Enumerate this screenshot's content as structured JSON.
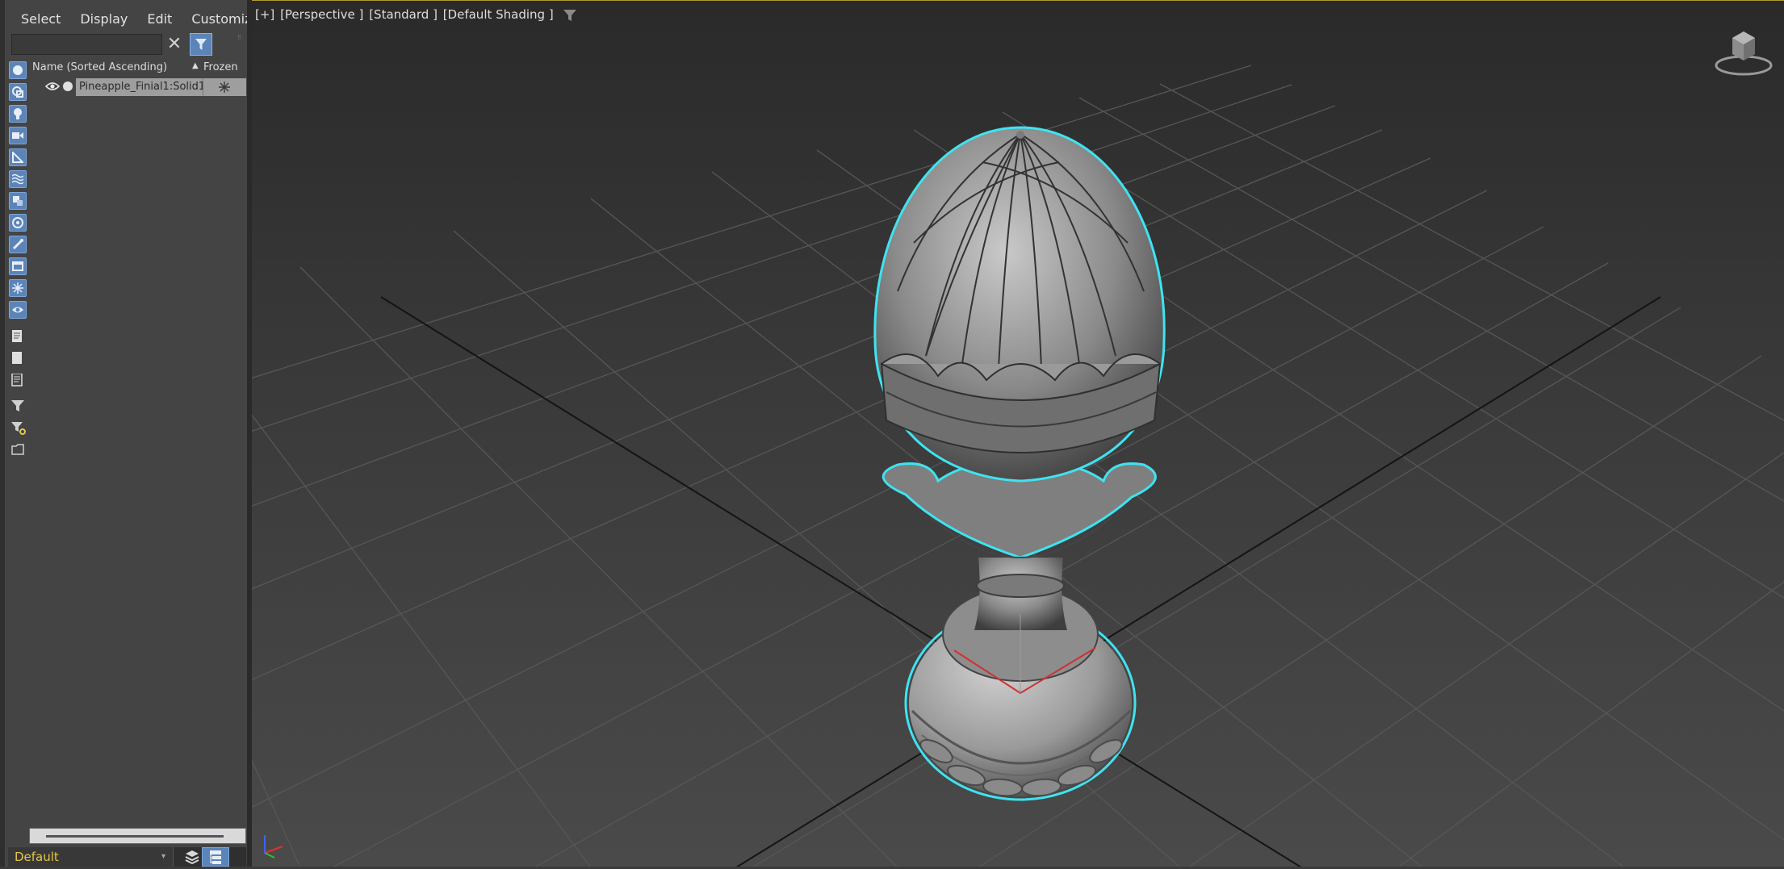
{
  "menu": {
    "items": [
      "Select",
      "Display",
      "Edit",
      "Customize"
    ]
  },
  "explorer": {
    "search_value": "",
    "columns": {
      "name": "Name (Sorted Ascending)",
      "sort_arrow": "▲",
      "frozen": "Frozen"
    },
    "rows": [
      {
        "name": "Pineapple_Finial1:Solid1",
        "visible": true,
        "frozen": false
      }
    ],
    "toolbar_icons": [
      "geometry-filter-icon",
      "shapes-filter-icon",
      "lights-filter-icon",
      "cameras-filter-icon",
      "helpers-filter-icon",
      "spacewarps-filter-icon",
      "groups-filter-icon",
      "xrefs-filter-icon",
      "bones-filter-icon",
      "containers-filter-icon",
      "frozen-filter-icon",
      "hidden-filter-icon",
      "display-all-icon",
      "display-none-icon",
      "invert-display-icon",
      "filter-icon",
      "select-filter-icon",
      "folder-icon"
    ],
    "layer": {
      "current": "Default"
    }
  },
  "viewport": {
    "labels": [
      "[+]",
      "[Perspective ]",
      "[Standard ]",
      "[Default Shading ]"
    ],
    "selection_color": "#3fe3f0",
    "grid_color": "#5a5a5a",
    "axis_colors": {
      "x": "#e03030",
      "y": "#30c030",
      "z": "#4060ff"
    },
    "active_border_color": "#b49a30"
  },
  "colors": {
    "panel_bg": "#444444",
    "accent_blue": "#5b84b9",
    "layer_text": "#e8c547"
  }
}
